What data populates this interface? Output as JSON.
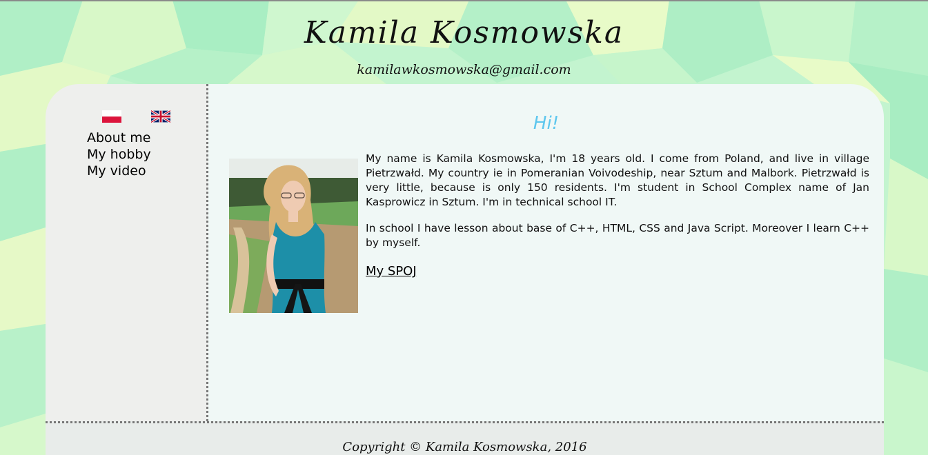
{
  "header": {
    "name": "Kamila  Kosmowska",
    "email": "kamilawkosmowska@gmail.com"
  },
  "languages": [
    {
      "code": "pl",
      "icon": "poland-flag-icon"
    },
    {
      "code": "en",
      "icon": "uk-flag-icon"
    }
  ],
  "nav": {
    "items": [
      {
        "label": "About me"
      },
      {
        "label": "My hobby"
      },
      {
        "label": "My video"
      }
    ]
  },
  "content": {
    "greeting": "Hi!",
    "paragraph1": "My name is Kamila Kosmowska, I'm 18 years old. I come from Poland, and live in village Pietrzwałd. My country ie in Pomeranian Voivodeship, near Sztum and Malbork. Pietrzwałd is very little, because is only 150 residents. I'm student in School Complex name of Jan Kasprowicz in Sztum. I'm in technical school IT.",
    "paragraph2": "In school I have lesson about base of C++, HTML, CSS and Java Script. Moreover I learn C++ by myself.",
    "link": "My SPOJ"
  },
  "footer": {
    "copyright": "Copyright © Kamila Kosmowska, 2016"
  },
  "colors": {
    "greeting": "#5ec7ee",
    "background_mint": "#b5f2c9",
    "background_cream": "#e6f9c7",
    "panel_main": "#f0f8f6",
    "panel_sidebar": "#eeefed"
  }
}
